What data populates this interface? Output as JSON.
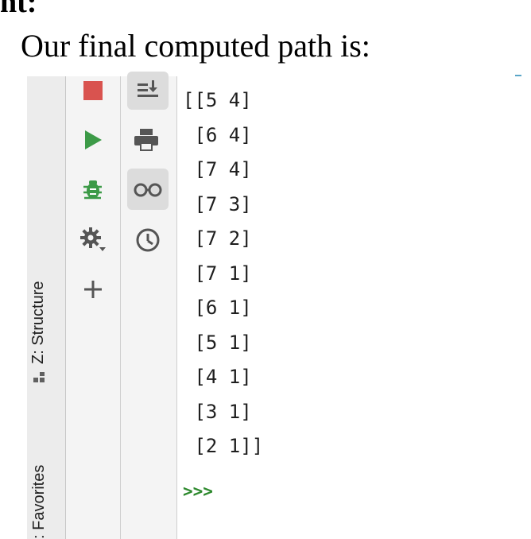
{
  "document": {
    "heading_fragment": "nt:",
    "intro": "Our final computed path is:"
  },
  "ide": {
    "side_tabs": {
      "structure": "Z: Structure",
      "favorites": ": Favorites"
    },
    "run_toolbar": [
      {
        "icon": "stop-icon",
        "color": "#d9534f"
      },
      {
        "icon": "run-icon",
        "color": "#3c9a47"
      },
      {
        "icon": "debug-bug-icon",
        "color": "#3c9a47"
      },
      {
        "icon": "settings-gear-icon",
        "color": "#555555"
      },
      {
        "icon": "add-icon",
        "color": "#555555"
      }
    ],
    "console_toolbar": [
      {
        "icon": "scroll-to-end-icon",
        "active": true
      },
      {
        "icon": "print-icon",
        "active": false
      },
      {
        "icon": "show-variables-glasses-icon",
        "active": true
      },
      {
        "icon": "history-clock-icon",
        "active": false
      }
    ],
    "console": {
      "output_lines": [
        "[[5 4]",
        " [6 4]",
        " [7 4]",
        " [7 3]",
        " [7 2]",
        " [7 1]",
        " [6 1]",
        " [5 1]",
        " [4 1]",
        " [3 1]",
        " [2 1]]"
      ],
      "prompt": ">>>",
      "prompt_color": "#2f8a2f"
    }
  }
}
